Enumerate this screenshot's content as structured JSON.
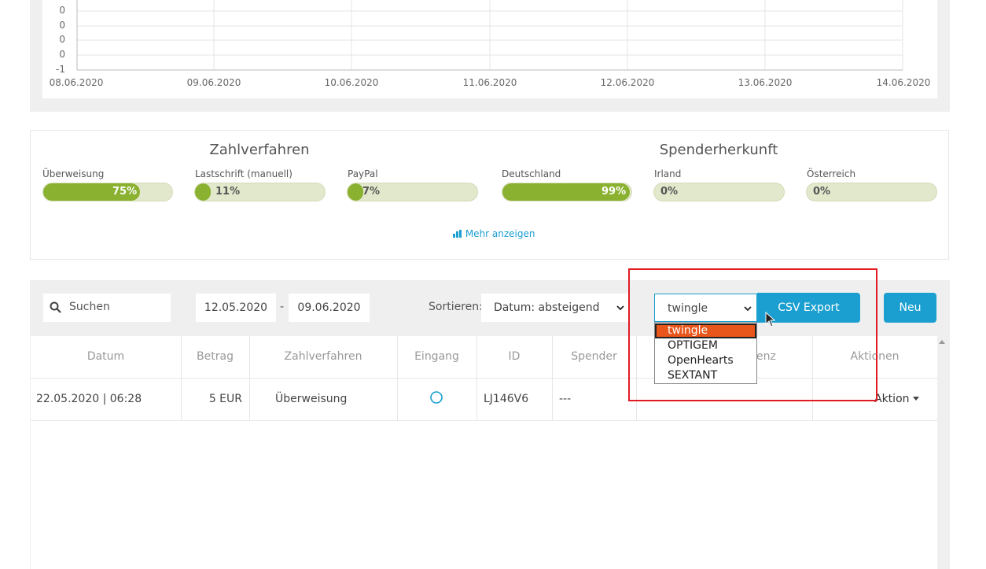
{
  "chart": {
    "y_ticks": [
      "0",
      "0",
      "0",
      "0",
      "-1"
    ],
    "x_ticks": [
      "08.06.2020",
      "09.06.2020",
      "10.06.2020",
      "11.06.2020",
      "12.06.2020",
      "13.06.2020",
      "14.06.2020"
    ]
  },
  "stats": {
    "payment_title": "Zahlverfahren",
    "origin_title": "Spenderherkunft",
    "payment_bars": [
      {
        "label": "Überweisung",
        "percent": 75,
        "text": "75%"
      },
      {
        "label": "Lastschrift (manuell)",
        "percent": 11,
        "text": "11%"
      },
      {
        "label": "PayPal",
        "percent": 7,
        "text": "7%"
      }
    ],
    "origin_bars": [
      {
        "label": "Deutschland",
        "percent": 99,
        "text": "99%"
      },
      {
        "label": "Irland",
        "percent": 0,
        "text": "0%"
      },
      {
        "label": "Österreich",
        "percent": 0,
        "text": "0%"
      }
    ],
    "more_link": "Mehr anzeigen",
    "bar_color": "#8ab12f",
    "track_color": "#e2e8cc"
  },
  "toolbar": {
    "search_placeholder": "Suchen",
    "date_from": "12.05.2020",
    "date_sep": "-",
    "date_to": "09.06.2020",
    "sort_label": "Sortieren:",
    "sort_value": "Datum: absteigend",
    "export_select_value": "twingle",
    "export_options": [
      "twingle",
      "OPTIGEM",
      "OpenHearts",
      "SEXTANT"
    ],
    "csv_export": "CSV Export",
    "new_button": "Neu",
    "accent_color": "#1a9fd0"
  },
  "table": {
    "headers": [
      "Datum",
      "Betrag",
      "Zahlverfahren",
      "Eingang",
      "ID",
      "Spender",
      "Referenz",
      "Aktionen"
    ],
    "visible_header_referenz": "enz",
    "rows": [
      {
        "datum": "22.05.2020 | 06:28",
        "betrag": "5 EUR",
        "zahlverfahren": "Überweisung",
        "id": "LJ146V6",
        "spender": "---",
        "aktion": "Aktion"
      }
    ]
  }
}
